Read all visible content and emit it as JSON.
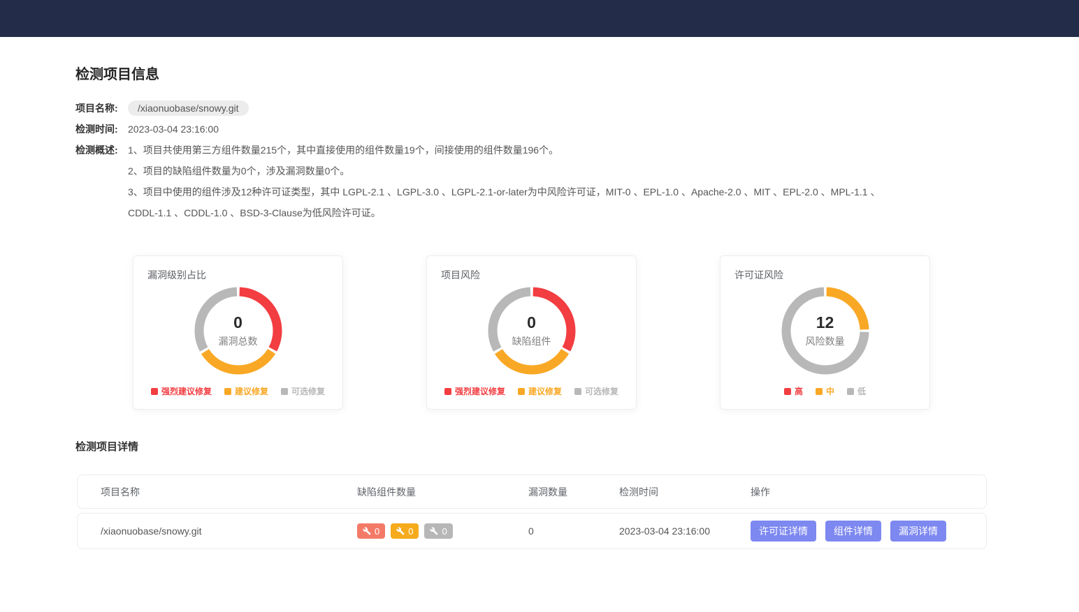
{
  "page": {
    "title": "检测项目信息"
  },
  "info": {
    "project_name_label": "项目名称:",
    "project_name_value": "/xiaonuobase/snowy.git",
    "detect_time_label": "检测时间:",
    "detect_time_value": "2023-03-04 23:16:00",
    "summary_label": "检测概述:",
    "summary_lines": [
      "1、项目共使用第三方组件数量215个，其中直接使用的组件数量19个，间接使用的组件数量196个。",
      "2、项目的缺陷组件数量为0个，涉及漏洞数量0个。",
      "3、项目中使用的组件涉及12种许可证类型，其中 LGPL-2.1 、LGPL-3.0 、LGPL-2.1-or-later为中风险许可证，MIT-0 、EPL-1.0 、Apache-2.0 、MIT 、EPL-2.0 、MPL-1.1 、",
      "CDDL-1.1 、CDDL-1.0 、BSD-3-Clause为低风险许可证。"
    ]
  },
  "palette": {
    "red": "#f23d41",
    "orange": "#f9a825",
    "gray": "#b8b8b8",
    "badge_red": "#f47a68",
    "badge_orange": "#f5ab1c",
    "badge_gray": "#b7b7b7",
    "button": "#7d88f0",
    "topbar": "#232d4a"
  },
  "chart_data": [
    {
      "type": "pie",
      "key": "vuln-level",
      "title": "漏洞级别占比",
      "center_value": "0",
      "center_label": "漏洞总数",
      "legend_position": "bottom",
      "segments": [
        {
          "label": "强烈建议修复",
          "color": "red",
          "value": 0,
          "display_pct": 33.33
        },
        {
          "label": "建议修复",
          "color": "orange",
          "value": 0,
          "display_pct": 33.33
        },
        {
          "label": "可选修复",
          "color": "gray",
          "value": 0,
          "display_pct": 33.34
        }
      ]
    },
    {
      "type": "pie",
      "key": "project-risk",
      "title": "项目风险",
      "center_value": "0",
      "center_label": "缺陷组件",
      "legend_position": "bottom",
      "segments": [
        {
          "label": "强烈建议修复",
          "color": "red",
          "value": 0,
          "display_pct": 33.33
        },
        {
          "label": "建议修复",
          "color": "orange",
          "value": 0,
          "display_pct": 33.33
        },
        {
          "label": "可选修复",
          "color": "gray",
          "value": 0,
          "display_pct": 33.34
        }
      ]
    },
    {
      "type": "pie",
      "key": "license-risk",
      "title": "许可证风险",
      "center_value": "12",
      "center_label": "风险数量",
      "legend_position": "bottom",
      "segments": [
        {
          "label": "高",
          "color": "red",
          "value": 0,
          "display_pct": 0
        },
        {
          "label": "中",
          "color": "orange",
          "value": 3,
          "display_pct": 25
        },
        {
          "label": "低",
          "color": "gray",
          "value": 9,
          "display_pct": 75
        }
      ]
    }
  ],
  "details": {
    "title": "检测项目详情"
  },
  "table": {
    "columns": [
      "项目名称",
      "缺陷组件数量",
      "漏洞数量",
      "检测时间",
      "操作"
    ],
    "row": {
      "project_name": "/xiaonuobase/snowy.git",
      "defect_badges": [
        {
          "key": "high",
          "color": "badge_red",
          "value": "0"
        },
        {
          "key": "medium",
          "color": "badge_orange",
          "value": "0"
        },
        {
          "key": "low",
          "color": "badge_gray",
          "value": "0"
        }
      ],
      "vuln_count": "0",
      "detect_time": "2023-03-04 23:16:00",
      "actions": [
        {
          "key": "license-detail",
          "label": "许可证详情"
        },
        {
          "key": "component-detail",
          "label": "组件详情"
        },
        {
          "key": "vuln-detail",
          "label": "漏洞详情"
        }
      ]
    }
  }
}
